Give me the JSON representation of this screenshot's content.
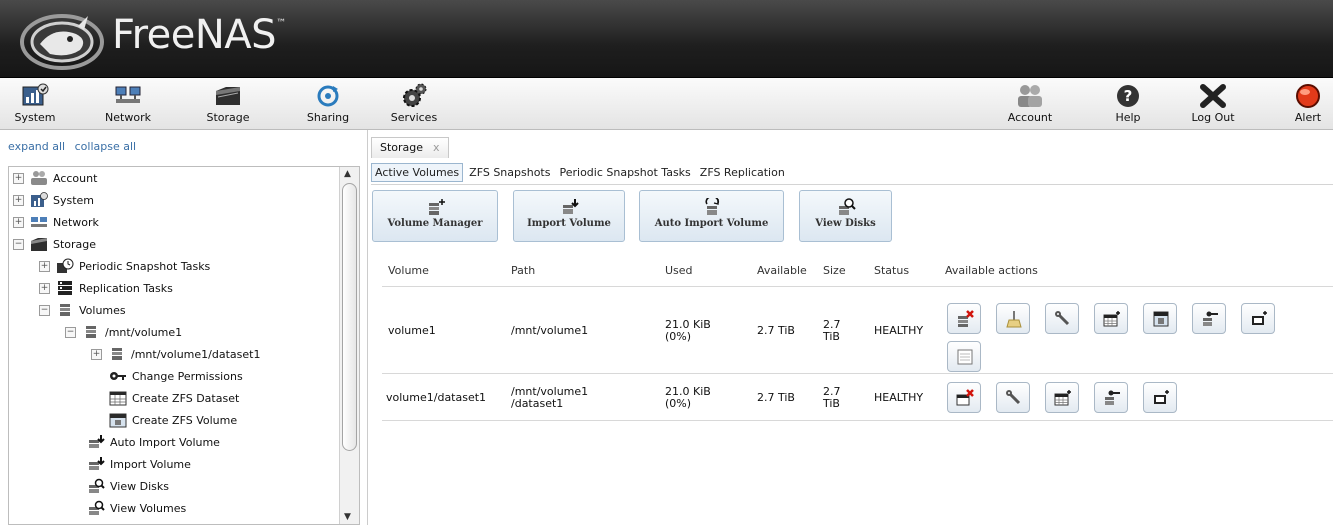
{
  "app": {
    "logo_text": "FreeNAS",
    "logo_tm": "™"
  },
  "toolbar": {
    "left": [
      {
        "label": "System",
        "icon": "system-icon"
      },
      {
        "label": "Network",
        "icon": "network-icon"
      },
      {
        "label": "Storage",
        "icon": "storage-icon"
      },
      {
        "label": "Sharing",
        "icon": "sharing-icon"
      },
      {
        "label": "Services",
        "icon": "services-icon"
      }
    ],
    "right": [
      {
        "label": "Account",
        "icon": "account-icon"
      },
      {
        "label": "Help",
        "icon": "help-icon"
      },
      {
        "label": "Log Out",
        "icon": "logout-icon"
      },
      {
        "label": "Alert",
        "icon": "alert-icon"
      }
    ]
  },
  "sidebar": {
    "expand_all": "expand all",
    "collapse_all": "collapse all",
    "tree": [
      {
        "label": "Account",
        "toggle": "+",
        "icon": "account-icon"
      },
      {
        "label": "System",
        "toggle": "+",
        "icon": "system-icon"
      },
      {
        "label": "Network",
        "toggle": "+",
        "icon": "network-icon"
      },
      {
        "label": "Storage",
        "toggle": "−",
        "icon": "storage-icon"
      },
      {
        "label": "Periodic Snapshot Tasks",
        "toggle": "+",
        "icon": "snapshot-clock-icon"
      },
      {
        "label": "Replication Tasks",
        "toggle": "+",
        "icon": "replication-icon"
      },
      {
        "label": "Volumes",
        "toggle": "−",
        "icon": "volume-icon"
      },
      {
        "label": "/mnt/volume1",
        "toggle": "−",
        "icon": "volume-icon"
      },
      {
        "label": "/mnt/volume1/dataset1",
        "toggle": "+",
        "icon": "volume-icon"
      },
      {
        "label": "Change Permissions",
        "toggle": "",
        "icon": "key-icon"
      },
      {
        "label": "Create ZFS Dataset",
        "toggle": "",
        "icon": "dataset-icon"
      },
      {
        "label": "Create ZFS Volume",
        "toggle": "",
        "icon": "zvol-icon"
      },
      {
        "label": "Auto Import Volume",
        "toggle": "",
        "icon": "import-icon"
      },
      {
        "label": "Import Volume",
        "toggle": "",
        "icon": "import-icon"
      },
      {
        "label": "View Disks",
        "toggle": "",
        "icon": "view-disks-icon"
      },
      {
        "label": "View Volumes",
        "toggle": "",
        "icon": "view-disks-icon"
      }
    ]
  },
  "main": {
    "tab_label": "Storage",
    "tab_close": "x",
    "subtabs": [
      "Active Volumes",
      "ZFS Snapshots",
      "Periodic Snapshot Tasks",
      "ZFS Replication"
    ],
    "buttons": [
      "Volume Manager",
      "Import Volume",
      "Auto Import Volume",
      "View Disks"
    ],
    "table": {
      "headers": [
        "Volume",
        "Path",
        "Used",
        "Available",
        "Size",
        "Status",
        "Available actions"
      ],
      "rows": [
        {
          "volume": "volume1",
          "path": [
            "/mnt/volume1"
          ],
          "used": [
            "21.0 KiB",
            "(0%)"
          ],
          "available": "2.7 TiB",
          "size": [
            "2.7",
            "TiB"
          ],
          "status": "HEALTHY",
          "actions": [
            "detach-volume",
            "scrub-volume",
            "edit-options",
            "create-dataset",
            "create-zvol",
            "change-permissions",
            "create-snapshot",
            "volume-status"
          ]
        },
        {
          "volume": "volume1/dataset1",
          "path": [
            "/mnt/volume1",
            "/dataset1"
          ],
          "used": [
            "21.0 KiB",
            "(0%)"
          ],
          "available": "2.7 TiB",
          "size": [
            "2.7",
            "TiB"
          ],
          "status": "HEALTHY",
          "actions": [
            "destroy-dataset",
            "edit-options",
            "create-dataset",
            "change-permissions",
            "create-snapshot"
          ]
        }
      ]
    }
  }
}
